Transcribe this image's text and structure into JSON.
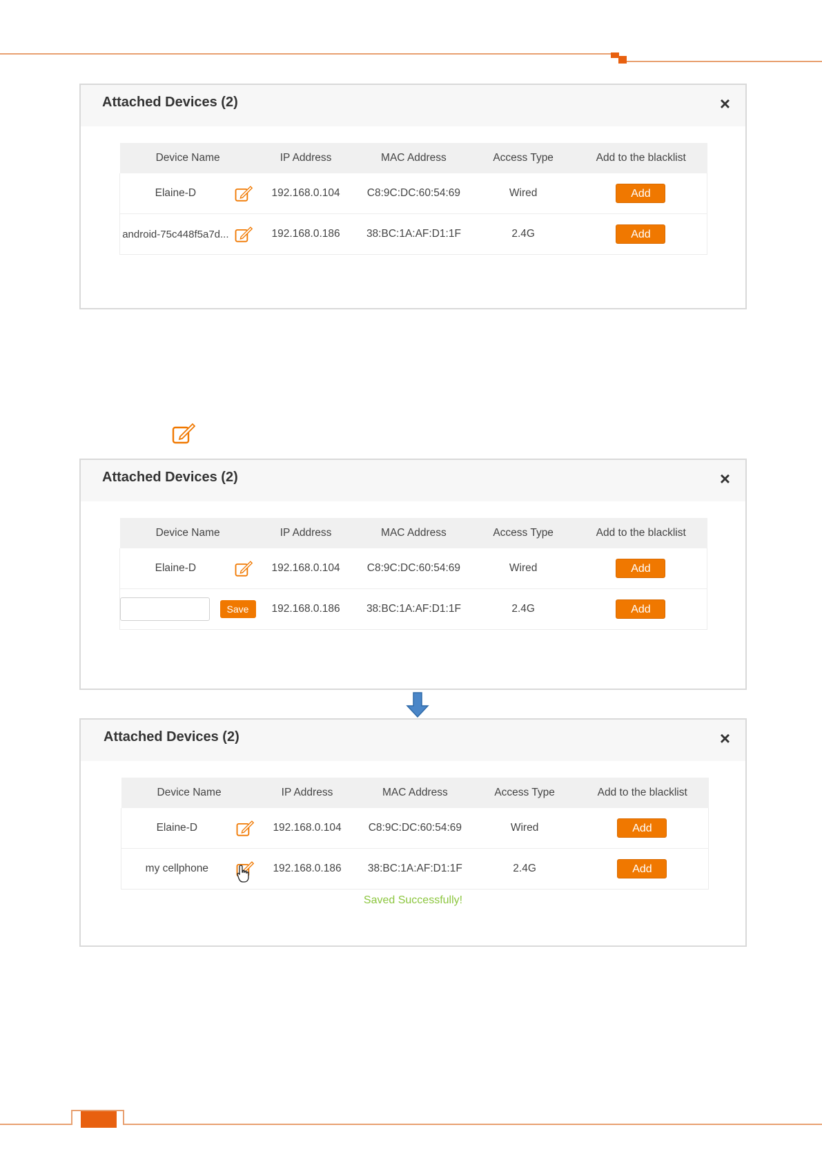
{
  "dialogs": [
    {
      "title": "Attached Devices (2)",
      "close": "×",
      "columns": [
        "Device Name",
        "IP Address",
        "MAC Address",
        "Access Type",
        "Add to the blacklist"
      ],
      "rows": [
        {
          "name": "Elaine-D",
          "ip": "192.168.0.104",
          "mac": "C8:9C:DC:60:54:69",
          "access": "Wired",
          "action": "Add"
        },
        {
          "name": "android-75c448f5a7d...",
          "ip": "192.168.0.186",
          "mac": "38:BC:1A:AF:D1:1F",
          "access": "2.4G",
          "action": "Add"
        }
      ]
    },
    {
      "title": "Attached Devices (2)",
      "close": "×",
      "columns": [
        "Device Name",
        "IP Address",
        "MAC Address",
        "Access Type",
        "Add to the blacklist"
      ],
      "rows": [
        {
          "name": "Elaine-D",
          "ip": "192.168.0.104",
          "mac": "C8:9C:DC:60:54:69",
          "access": "Wired",
          "action": "Add"
        },
        {
          "name_input_value": "",
          "save": "Save",
          "ip": "192.168.0.186",
          "mac": "38:BC:1A:AF:D1:1F",
          "access": "2.4G",
          "action": "Add"
        }
      ]
    },
    {
      "title": "Attached Devices (2)",
      "close": "×",
      "columns": [
        "Device Name",
        "IP Address",
        "MAC Address",
        "Access Type",
        "Add to the blacklist"
      ],
      "rows": [
        {
          "name": "Elaine-D",
          "ip": "192.168.0.104",
          "mac": "C8:9C:DC:60:54:69",
          "access": "Wired",
          "action": "Add"
        },
        {
          "name": "my cellphone",
          "ip": "192.168.0.186",
          "mac": "38:BC:1A:AF:D1:1F",
          "access": "2.4G",
          "action": "Add"
        }
      ],
      "message": "Saved Successfully!"
    }
  ],
  "colors": {
    "accent": "#f07800",
    "success": "#8cc63f",
    "arrow": "#4a86c8"
  },
  "icons": [
    "edit-icon",
    "close-icon",
    "down-arrow-icon",
    "hand-cursor-icon"
  ]
}
